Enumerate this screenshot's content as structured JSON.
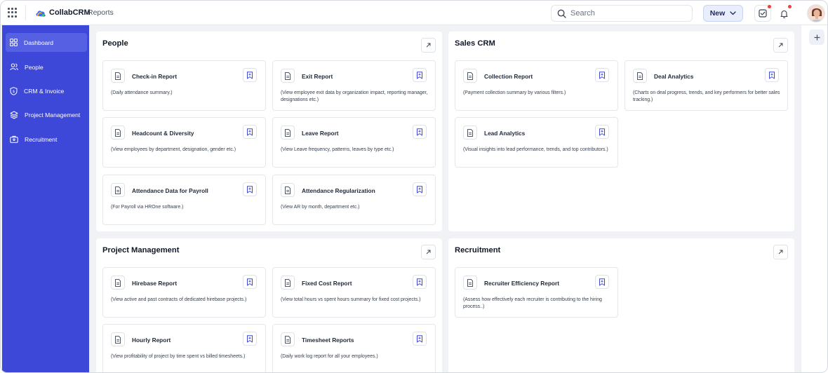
{
  "app": {
    "name": "CollabCRM",
    "breadcrumb": "Reports"
  },
  "header": {
    "search_placeholder": "Search",
    "new_label": "New"
  },
  "colors": {
    "sidebar": "#3e48d8",
    "sidebar_active": "#5660e3",
    "notification_dot": "#ef3e3e",
    "brand_blue": "#3b6cf6"
  },
  "sidebar": {
    "items": [
      {
        "label": "Dashboard",
        "icon": "dashboard-grid-icon"
      },
      {
        "label": "People",
        "icon": "users-icon"
      },
      {
        "label": "CRM & Invoice",
        "icon": "shield-icon"
      },
      {
        "label": "Project Management",
        "icon": "layers-icon"
      },
      {
        "label": "Recruitment",
        "icon": "briefcase-icon"
      }
    ]
  },
  "sections": {
    "people": {
      "title": "People",
      "cards": [
        {
          "title": "Check-in Report",
          "desc": "(Daily attendance summary.)"
        },
        {
          "title": "Exit Report",
          "desc": "(View employee exit data by organization impact, reporting manager, designations etc.)"
        },
        {
          "title": "Headcount & Diversity",
          "desc": "(View employees by department, designation, gender etc.)"
        },
        {
          "title": "Leave Report",
          "desc": "(View Leave frequency, patterns, leaves by type etc.)"
        },
        {
          "title": "Attendance Data for Payroll",
          "desc": "(For Payroll via HROne software.)"
        },
        {
          "title": "Attendance Regularization",
          "desc": "(View AR by month, department etc.)"
        }
      ]
    },
    "sales": {
      "title": "Sales CRM",
      "cards": [
        {
          "title": "Collection Report",
          "desc": "(Payment collection summary by various filters.)"
        },
        {
          "title": "Deal Analytics",
          "desc": "(Charts on deal progress, trends, and key performers for better sales tracking.)"
        },
        {
          "title": "Lead Analytics",
          "desc": "(Visual insights into lead performance, trends, and top contributors.)"
        }
      ]
    },
    "project": {
      "title": "Project Management",
      "cards": [
        {
          "title": "Hirebase Report",
          "desc": "(View active and past contracts of dedicated hirebase projects.)"
        },
        {
          "title": "Fixed Cost Report",
          "desc": "(View total hours vs spent hours summary for fixed cost projects.)"
        },
        {
          "title": "Hourly Report",
          "desc": "(View profitability of project by time spent vs billed timesheets.)"
        },
        {
          "title": "Timesheet Reports",
          "desc": "(Daily work log report for all your employees.)"
        }
      ]
    },
    "recruitment": {
      "title": "Recruitment",
      "cards": [
        {
          "title": "Recruiter Efficiency Report",
          "desc": "(Assess how effectively each recruiter is contributing to the hiring process..)"
        }
      ]
    }
  }
}
